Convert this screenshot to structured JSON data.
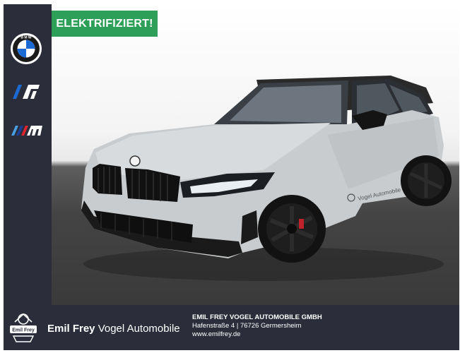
{
  "badge": {
    "text": "ELEKTRIFIZIERT!",
    "color": "#2e9f58"
  },
  "sidebar": {
    "icons": [
      "bmw-roundel-icon",
      "bmw-i-icon",
      "bmw-m-icon"
    ]
  },
  "car": {
    "door_text": "Vogel Automobile"
  },
  "footer": {
    "logo_text": "Emil Frey",
    "brand_bold": "Emil Frey",
    "brand_rest": " Vogel Automobile",
    "dealer_name": "EMIL FREY VOGEL AUTOMOBILE GMBH",
    "address": "Hafenstraße 4 | 76726 Germersheim",
    "website": "www.emilfrey.de"
  },
  "colors": {
    "sidebar_bg": "#2b2e3a",
    "badge_bg": "#2e9f58",
    "car_body": "#c9ccce"
  }
}
